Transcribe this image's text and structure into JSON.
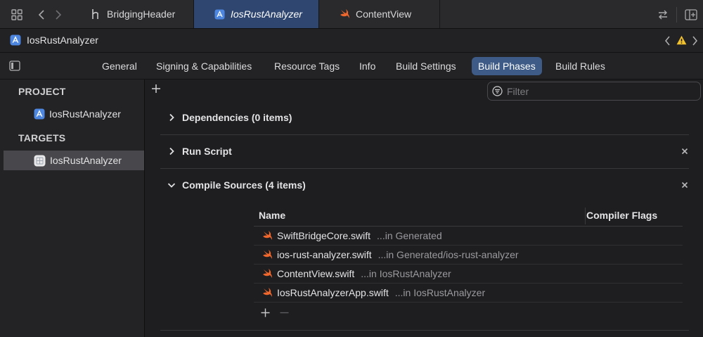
{
  "tabs": [
    {
      "label": "BridgingHeader",
      "icon": "h-header-icon",
      "active": false
    },
    {
      "label": "IosRustAnalyzer",
      "icon": "xcode-project-icon",
      "active": true
    },
    {
      "label": "ContentView",
      "icon": "swift-icon",
      "active": false
    }
  ],
  "breadcrumb": {
    "project": "IosRustAnalyzer"
  },
  "editor_tabs": [
    "General",
    "Signing & Capabilities",
    "Resource Tags",
    "Info",
    "Build Settings",
    "Build Phases",
    "Build Rules"
  ],
  "selected_editor_tab": "Build Phases",
  "sidebar": {
    "project_header": "PROJECT",
    "project_item": "IosRustAnalyzer",
    "targets_header": "TARGETS",
    "target_item": "IosRustAnalyzer"
  },
  "filter": {
    "placeholder": "Filter",
    "value": ""
  },
  "phases": {
    "dependencies": "Dependencies (0 items)",
    "run_script": "Run Script",
    "compile_sources": "Compile Sources (4 items)"
  },
  "compile_table": {
    "columns": [
      "Name",
      "Compiler Flags"
    ],
    "rows": [
      {
        "name": "SwiftBridgeCore.swift",
        "location": "...in Generated"
      },
      {
        "name": "ios-rust-analyzer.swift",
        "location": "...in Generated/ios-rust-analyzer"
      },
      {
        "name": "ContentView.swift",
        "location": "...in IosRustAnalyzer"
      },
      {
        "name": "IosRustAnalyzerApp.swift",
        "location": "...in IosRustAnalyzer"
      }
    ]
  },
  "colors": {
    "accent": "#3d5b86",
    "active_tab": "#2e4670",
    "swift_orange": "#f0672e",
    "warning": "#f2c12e"
  }
}
